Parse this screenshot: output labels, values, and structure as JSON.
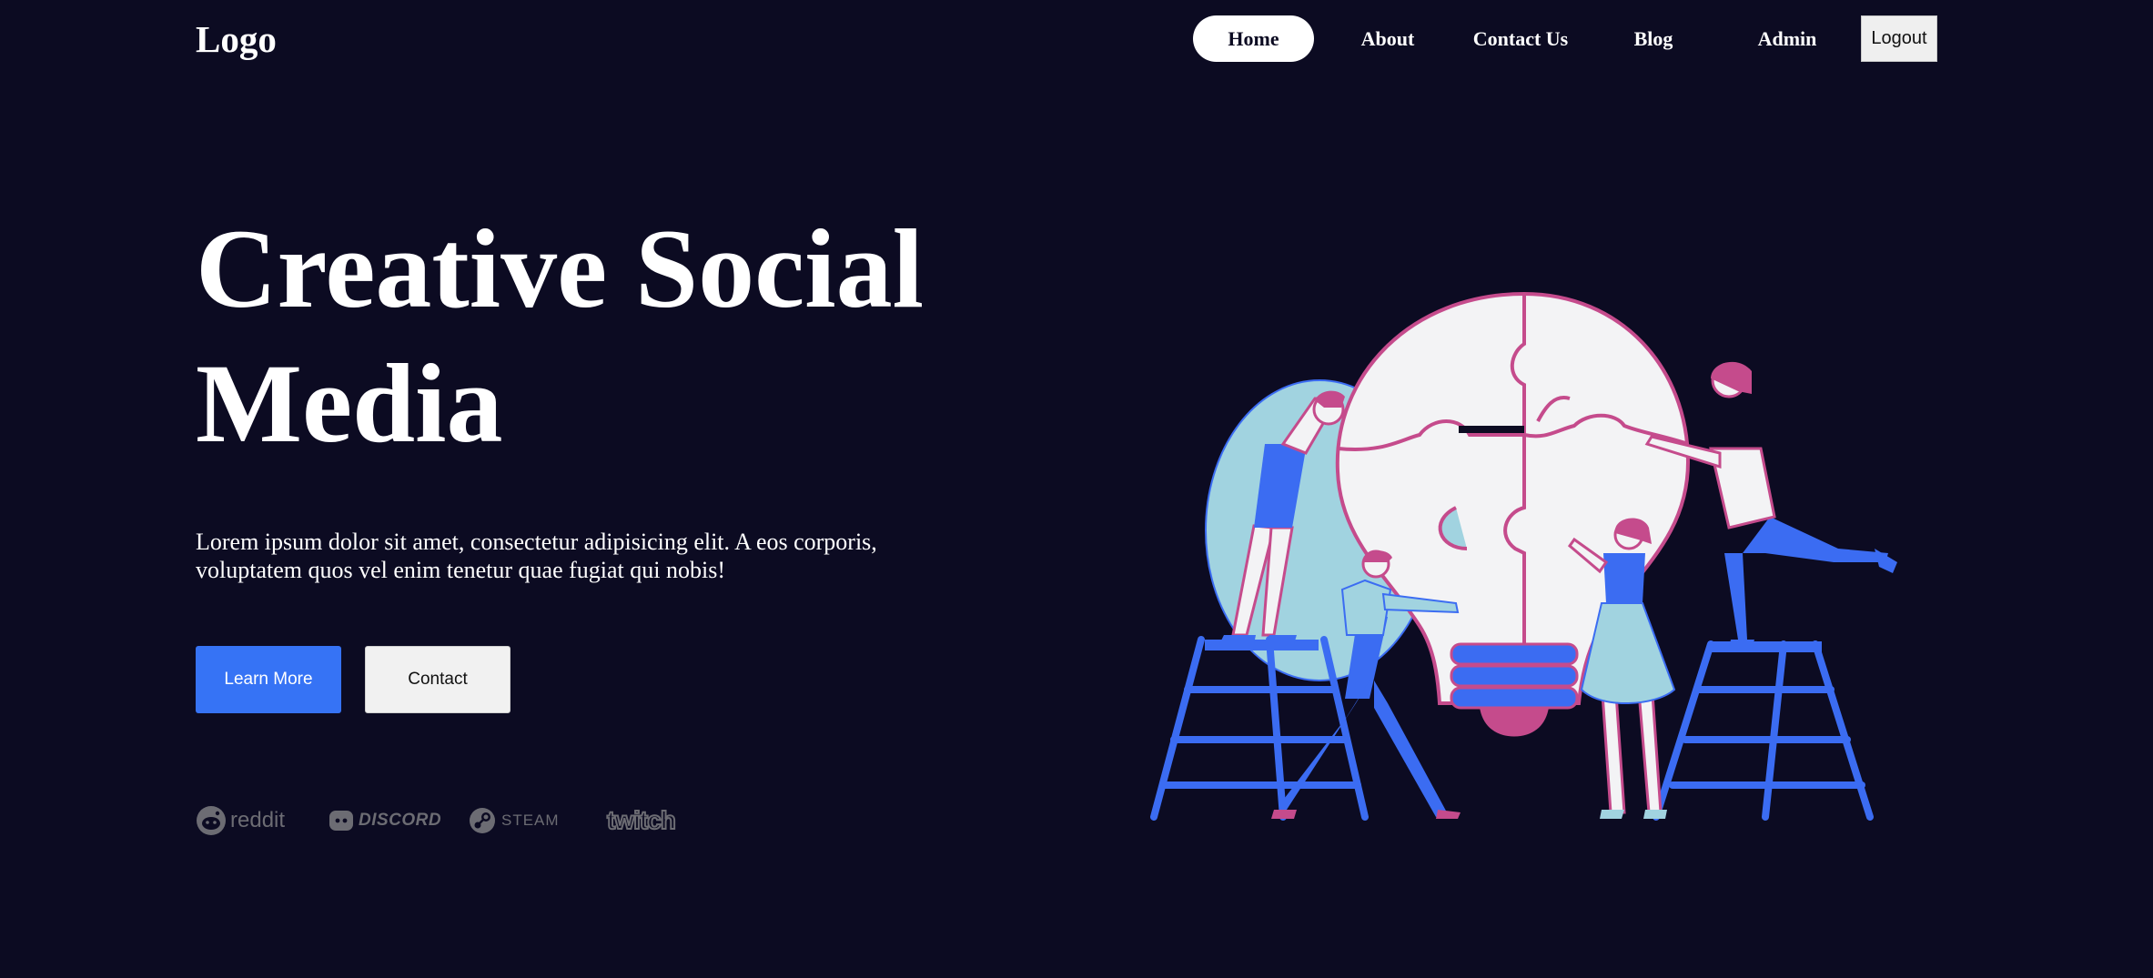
{
  "header": {
    "logo": "Logo",
    "nav": [
      {
        "label": "Home",
        "active": true
      },
      {
        "label": "About",
        "active": false
      },
      {
        "label": "Contact Us",
        "active": false
      },
      {
        "label": "Blog",
        "active": false
      },
      {
        "label": "Admin",
        "active": false
      }
    ],
    "logout_label": "Logout"
  },
  "hero": {
    "title_line1": "Creative Social",
    "title_line2": "Media",
    "description": "Lorem ipsum dolor sit amet, consectetur adipisicing elit. A eos corporis, voluptatem quos vel enim tenetur quae fugiat qui nobis!",
    "learn_more_label": "Learn More",
    "contact_label": "Contact"
  },
  "brands": [
    {
      "name": "reddit",
      "icon": "reddit-icon"
    },
    {
      "name": "DISCORD",
      "icon": "discord-icon"
    },
    {
      "name": "STEAM",
      "icon": "steam-icon"
    },
    {
      "name": "twitch",
      "icon": "twitch-icon"
    }
  ],
  "illustration": {
    "icon": "lightbulb-puzzle-team-illustration",
    "colors": {
      "blue": "#3b6cf2",
      "pink": "#c54b8c",
      "light": "#f3f3f5",
      "teal": "#a1d3e0"
    }
  },
  "colors": {
    "background": "#0c0b22",
    "primary": "#3673f5",
    "text": "#ffffff",
    "muted": "#6c6c73"
  }
}
